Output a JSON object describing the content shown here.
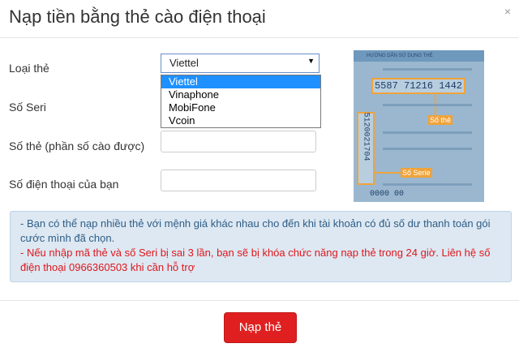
{
  "dialog": {
    "title": "Nạp tiền bằng thẻ cào điện thoại",
    "close_icon": "×"
  },
  "form": {
    "card_type_label": "Loại thẻ",
    "serial_label": "Số Seri",
    "card_number_label": "Số thẻ (phần số cào được)",
    "phone_label": "Số điện thoại của bạn",
    "card_type_selected": "Viettel",
    "card_type_options": [
      "Viettel",
      "Vinaphone",
      "MobiFone",
      "Vcoin"
    ],
    "serial_value": "",
    "card_number_value": "",
    "phone_value": ""
  },
  "card_image": {
    "card_number_sample": "5587 71216 1442",
    "serial_sample": "5120021704",
    "card_number_tag": "Số thẻ",
    "serial_tag": "Số Serie",
    "caption": "HƯỚNG DẪN SỬ DỤNG THẺ",
    "bottom_text": "0000 00"
  },
  "note": {
    "line1": "- Bạn có thể nạp nhiều thẻ với mệnh giá khác nhau cho đến khi tài khoản có đủ số dư thanh toán gói cước mình đã chọn.",
    "line2": "- Nếu nhập mã thẻ và số Seri bị sai 3 lần, bạn sẽ bị khóa chức năng nạp thẻ trong 24 giờ. Liên hệ số điện thoại 0966360503 khi cần hỗ trợ"
  },
  "footer": {
    "submit_label": "Nạp thẻ"
  },
  "colors": {
    "accent": "#e02020",
    "note_bg": "#dde8f2",
    "warning": "#e0161c",
    "info": "#2e5d86",
    "selection": "#1e90ff"
  }
}
